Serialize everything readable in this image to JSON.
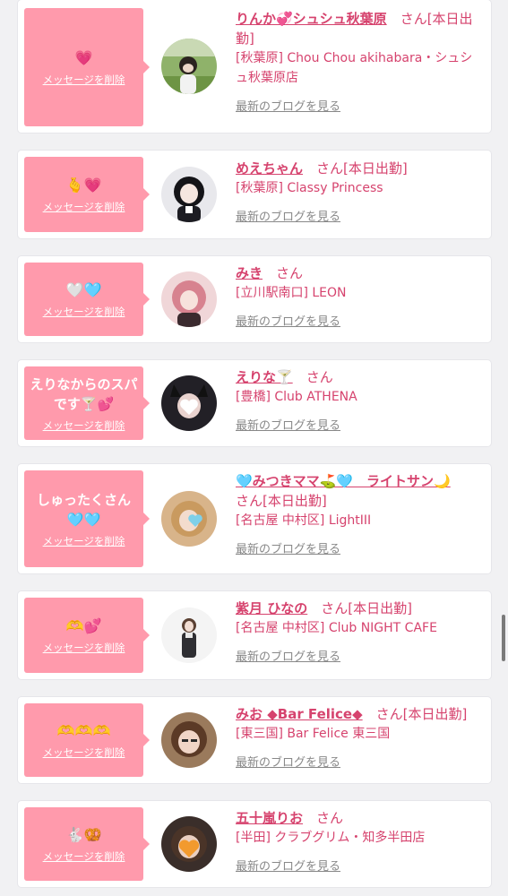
{
  "delete_label": "メッセージを削除",
  "blog_label": "最新のブログを見る",
  "colors": {
    "bubble": "#ff9aac",
    "name": "#d6436e",
    "blog_link": "#888888"
  },
  "items": [
    {
      "bubble_text": "",
      "bubble_emoji": "💗",
      "name": "りんか💞シュシュ秋葉原",
      "suffix": "さん[本日出勤]",
      "shop": "[秋葉原] Chou Chou akihabara・シュシュ秋葉原店",
      "avatar_icon": "avatar-photo-outdoor-girl"
    },
    {
      "bubble_text": "",
      "bubble_emoji": "🫰💗",
      "name": "めえちゃん",
      "suffix": "さん[本日出勤]",
      "shop": "[秋葉原] Classy Princess",
      "avatar_icon": "avatar-photo-dark-hair-girl"
    },
    {
      "bubble_text": "",
      "bubble_emoji": "🤍🩵",
      "name": "みき",
      "suffix": "さん",
      "shop": "[立川駅南口] LEON",
      "avatar_icon": "avatar-photo-pink-hair-girl"
    },
    {
      "bubble_text": "えりなからのスパです🍸💕",
      "bubble_emoji": "",
      "name": "えりな🍸",
      "suffix": "さん",
      "shop": "[豊橋] Club ATHENA",
      "avatar_icon": "avatar-photo-cat-ears-heart"
    },
    {
      "bubble_text": "しゅったくさん🩵🩵",
      "bubble_emoji": "",
      "name": "🩵みつきママ⛳🩵　ライトサン🌙",
      "suffix": "さん[本日出勤]",
      "shop": "[名古屋 中村区] LightIII",
      "avatar_icon": "avatar-photo-blonde-heart"
    },
    {
      "bubble_text": "",
      "bubble_emoji": "🫶💕",
      "name": "紫月 ひなの",
      "suffix": "さん[本日出勤]",
      "shop": "[名古屋 中村区] Club NIGHT CAFE",
      "avatar_icon": "avatar-photo-standing-girl"
    },
    {
      "bubble_text": "",
      "bubble_emoji": "🫶🫶🫶",
      "name": "みお ◆Bar Felice◆",
      "suffix": "さん[本日出勤]",
      "shop": "[東三国] Bar Felice 東三国",
      "avatar_icon": "avatar-photo-brown-hair-girl"
    },
    {
      "bubble_text": "",
      "bubble_emoji": "🐇🥨",
      "name": "五十嵐りお",
      "suffix": "さん",
      "shop": "[半田] クラブグリム・知多半田店",
      "avatar_icon": "avatar-photo-orange-heart"
    }
  ]
}
